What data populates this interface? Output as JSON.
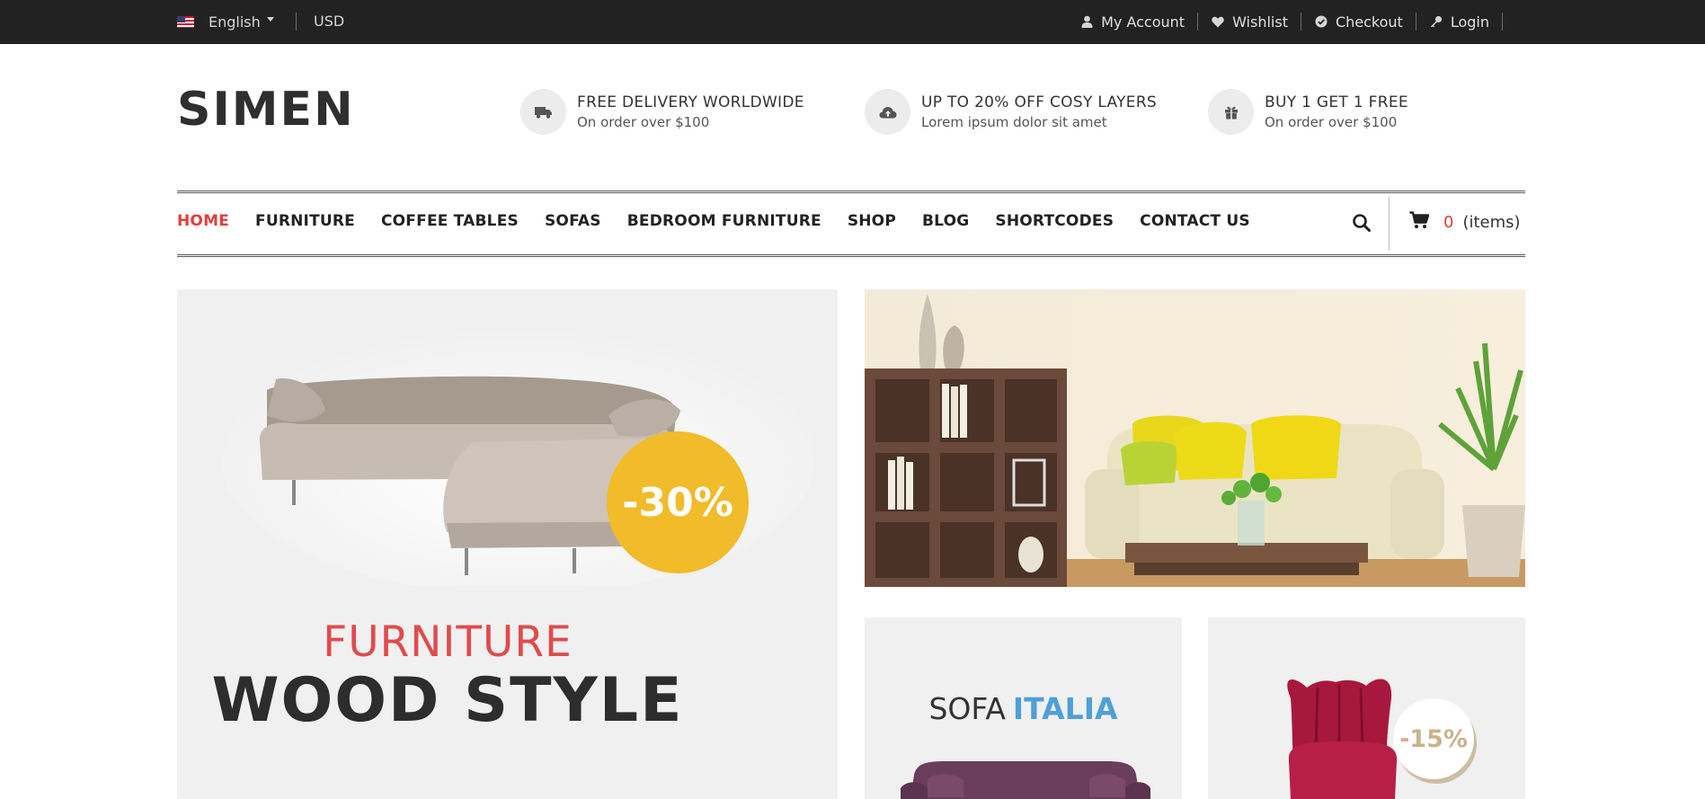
{
  "topbar": {
    "language": "English",
    "currency": "USD",
    "links": [
      {
        "label": "My Account",
        "icon": "user-icon"
      },
      {
        "label": "Wishlist",
        "icon": "heart-icon"
      },
      {
        "label": "Checkout",
        "icon": "check-circle-icon"
      },
      {
        "label": "Login",
        "icon": "key-icon"
      }
    ]
  },
  "header": {
    "logo": "SIMEN",
    "features": [
      {
        "icon": "truck-icon",
        "title": "FREE DELIVERY WORLDWIDE",
        "subtitle": "On order over $100"
      },
      {
        "icon": "cloud-upload-icon",
        "title": "UP TO 20% OFF COSY LAYERS",
        "subtitle": "Lorem ipsum dolor sit amet"
      },
      {
        "icon": "gift-icon",
        "title": "BUY 1 GET 1 FREE",
        "subtitle": "On order over $100"
      }
    ]
  },
  "nav": {
    "items": [
      "HOME",
      "FURNITURE",
      "COFFEE TABLES",
      "SOFAS",
      "BEDROOM FURNITURE",
      "SHOP",
      "BLOG",
      "SHORTCODES",
      "CONTACT US"
    ],
    "active": "HOME",
    "cart_count": "0",
    "cart_label": "(items)"
  },
  "banners": {
    "main": {
      "badge": "-30%",
      "subtitle": "FURNITURE",
      "title": "WOOD STYLE"
    },
    "sofa": {
      "title_plain": "SOFA",
      "title_highlight": "ITALIA"
    },
    "chair": {
      "badge": "-15%"
    }
  },
  "colors": {
    "topbar_bg": "#222222",
    "accent_red": "#e03e3e",
    "badge_yellow": "#f1bb29",
    "italia_blue": "#4f9fd8"
  }
}
